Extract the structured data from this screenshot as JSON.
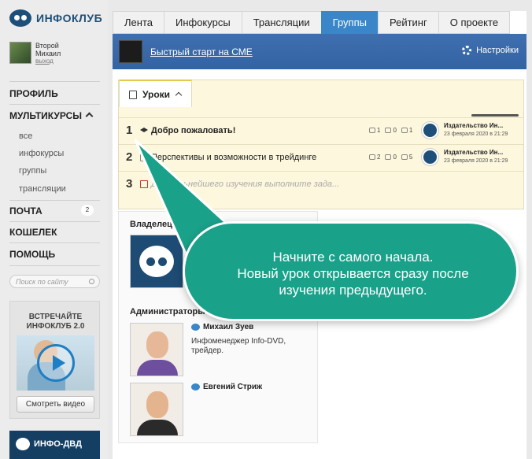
{
  "logo": {
    "text": "ИНФОКЛУБ"
  },
  "user": {
    "first_name": "Второй",
    "last_name": "Михаил",
    "logout": "выход"
  },
  "sidebar": {
    "profile": "ПРОФИЛЬ",
    "multicourses": "МУЛЬТИКУРСЫ",
    "sub_items": [
      "все",
      "инфокурсы",
      "группы",
      "трансляции"
    ],
    "mail": "ПОЧТА",
    "mail_count": "2",
    "wallet": "КОШЕЛЕК",
    "help": "ПОМОЩЬ"
  },
  "search": {
    "placeholder": "Поиск по сайту"
  },
  "promo": {
    "title_line1": "ВСТРЕЧАЙТЕ",
    "title_line2": "ИНФОКЛУБ 2.0",
    "button": "Смотреть видео"
  },
  "infodvd": {
    "text": "ИНФО-ДВД"
  },
  "tabs": [
    "Лента",
    "Инфокурсы",
    "Трансляции",
    "Группы",
    "Рейтинг",
    "О проекте"
  ],
  "active_tab": "Группы",
  "banner": {
    "link": "Быстрый старт на СМЕ",
    "settings": "Настройки"
  },
  "lessons": {
    "label": "Уроки",
    "rows": [
      {
        "num": "1",
        "title": "Добро пожаловать!",
        "students": "1",
        "comments": "0",
        "views": "1",
        "author": "Издательство Ин...",
        "date": "23 февраля 2020 в 21:29"
      },
      {
        "num": "2",
        "title": "Перспективы и возможности в трейдинге",
        "students": "2",
        "comments": "0",
        "views": "5",
        "author": "Издательство Ин...",
        "date": "23 февраля 2020 в 21:29"
      },
      {
        "num": "3",
        "title": "Для дальнейшего изучения выполните зада..."
      }
    ]
  },
  "owners": {
    "owner_title": "Владелец группы",
    "admins_title": "Администраторы",
    "admins": [
      {
        "name": "Михаил Зуев",
        "desc": "Инфоменеджер Info-DVD, трейдер."
      },
      {
        "name": "Евгений Стриж",
        "desc": ""
      }
    ]
  },
  "callout": {
    "line1": "Начните с самого начала.",
    "line2": "Новый урок открывается сразу после",
    "line3": "изучения предыдущего."
  },
  "colors": {
    "accent": "#3a86c8",
    "callout": "#1aa18a",
    "lessons_bg": "#fdf7dd"
  }
}
